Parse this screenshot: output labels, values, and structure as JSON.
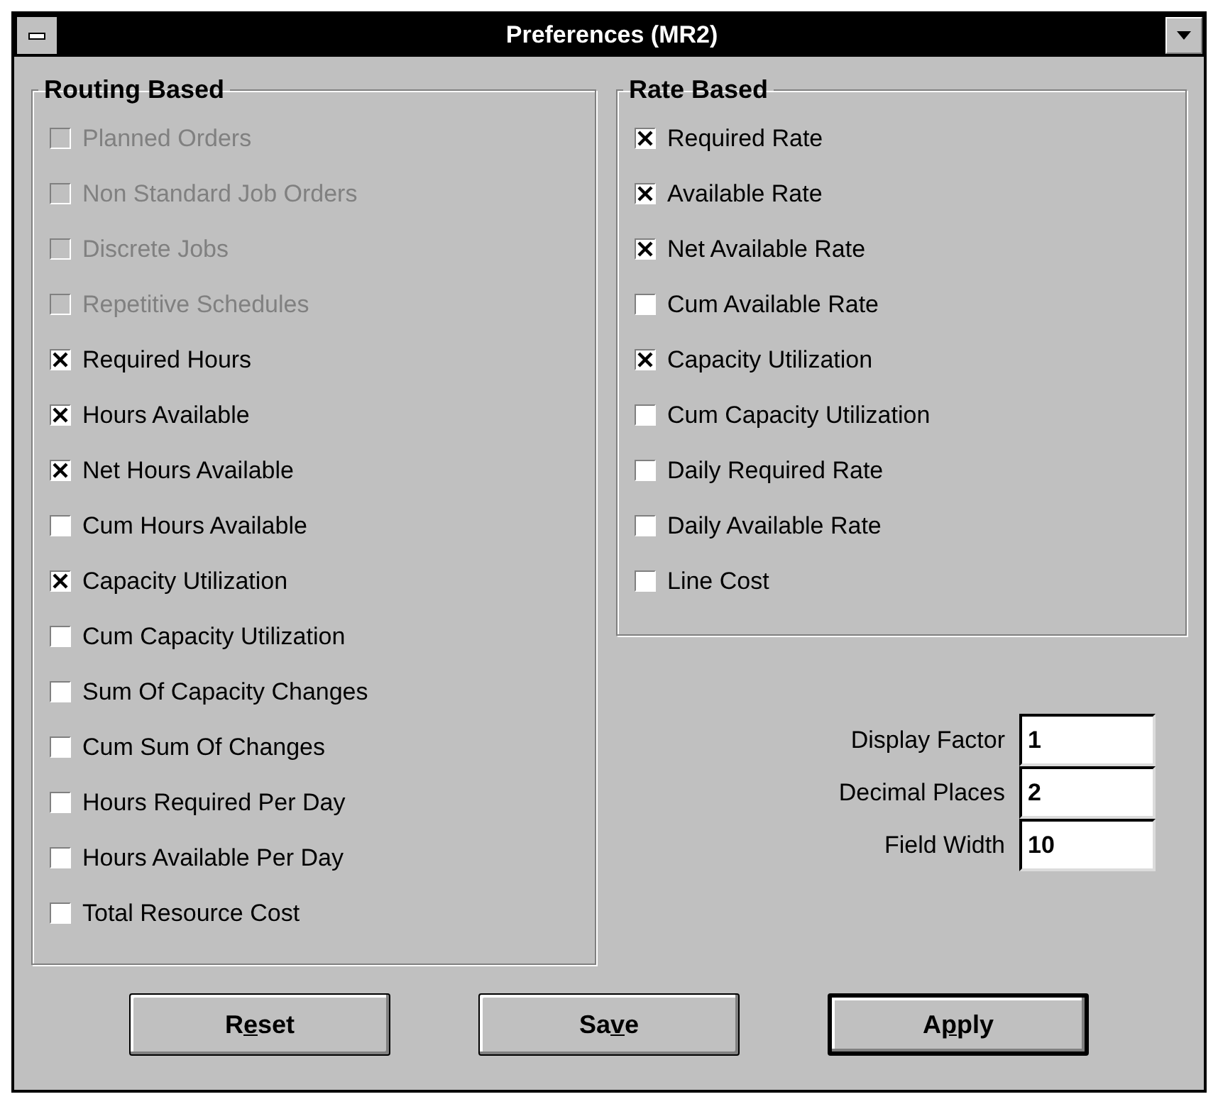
{
  "window": {
    "title": "Preferences (MR2)"
  },
  "routing_based": {
    "title": "Routing Based",
    "items": [
      {
        "label": "Planned Orders",
        "checked": false,
        "disabled": true
      },
      {
        "label": "Non Standard Job Orders",
        "checked": false,
        "disabled": true
      },
      {
        "label": "Discrete Jobs",
        "checked": false,
        "disabled": true
      },
      {
        "label": "Repetitive Schedules",
        "checked": false,
        "disabled": true
      },
      {
        "label": "Required Hours",
        "checked": true,
        "disabled": false
      },
      {
        "label": "Hours Available",
        "checked": true,
        "disabled": false
      },
      {
        "label": "Net Hours Available",
        "checked": true,
        "disabled": false
      },
      {
        "label": "Cum Hours Available",
        "checked": false,
        "disabled": false
      },
      {
        "label": "Capacity Utilization",
        "checked": true,
        "disabled": false
      },
      {
        "label": "Cum Capacity Utilization",
        "checked": false,
        "disabled": false
      },
      {
        "label": "Sum Of Capacity Changes",
        "checked": false,
        "disabled": false
      },
      {
        "label": "Cum Sum Of Changes",
        "checked": false,
        "disabled": false
      },
      {
        "label": "Hours Required Per Day",
        "checked": false,
        "disabled": false
      },
      {
        "label": "Hours Available Per Day",
        "checked": false,
        "disabled": false
      },
      {
        "label": "Total Resource Cost",
        "checked": false,
        "disabled": false
      }
    ]
  },
  "rate_based": {
    "title": "Rate Based",
    "items": [
      {
        "label": "Required Rate",
        "checked": true,
        "disabled": false
      },
      {
        "label": "Available Rate",
        "checked": true,
        "disabled": false
      },
      {
        "label": "Net Available Rate",
        "checked": true,
        "disabled": false
      },
      {
        "label": "Cum Available Rate",
        "checked": false,
        "disabled": false
      },
      {
        "label": "Capacity Utilization",
        "checked": true,
        "disabled": false
      },
      {
        "label": "Cum Capacity Utilization",
        "checked": false,
        "disabled": false
      },
      {
        "label": "Daily Required Rate",
        "checked": false,
        "disabled": false
      },
      {
        "label": "Daily Available Rate",
        "checked": false,
        "disabled": false
      },
      {
        "label": "Line Cost",
        "checked": false,
        "disabled": false
      }
    ]
  },
  "fields": [
    {
      "label": "Display Factor",
      "value": "1"
    },
    {
      "label": "Decimal Places",
      "value": "2"
    },
    {
      "label": "Field Width",
      "value": "10"
    }
  ],
  "buttons": [
    {
      "label_start": "R",
      "mnemonic": "e",
      "label_end": "set",
      "default": false
    },
    {
      "label_start": "Sa",
      "mnemonic": "v",
      "label_end": "e",
      "default": false
    },
    {
      "label_start": "A",
      "mnemonic": "p",
      "label_end": "ply",
      "default": true
    }
  ]
}
